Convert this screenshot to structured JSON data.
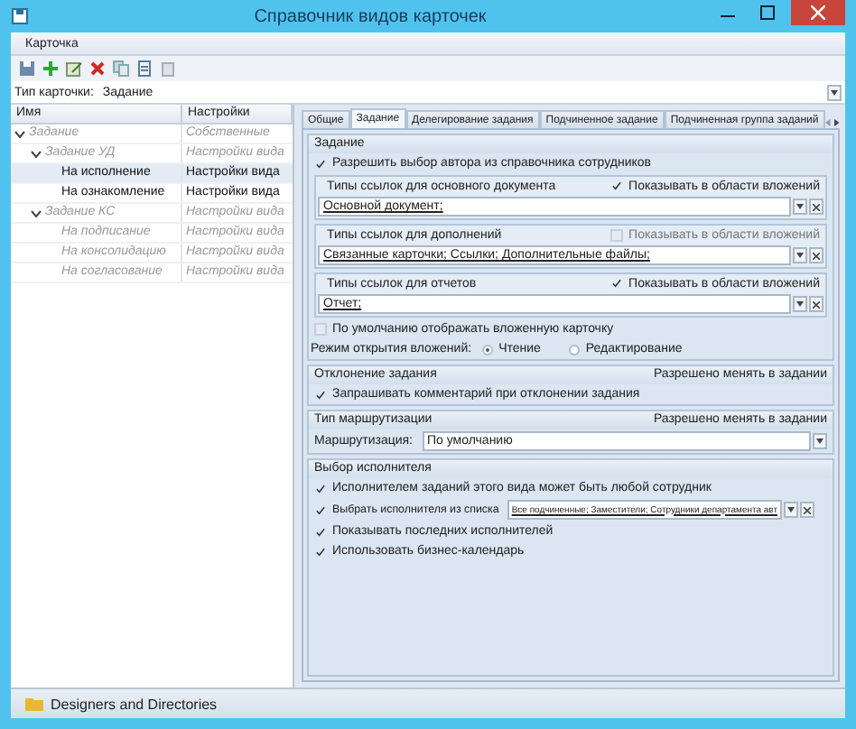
{
  "window": {
    "title": "Справочник видов карточек"
  },
  "menu": [
    "Карточка"
  ],
  "card_type": {
    "label": "Тип карточки:",
    "value": "Задание"
  },
  "tree": {
    "columns": [
      "Имя",
      "Настройки"
    ],
    "rows": [
      {
        "name": "Задание",
        "setting": "Собственные",
        "inherited": true,
        "selected": false,
        "expanded": true,
        "children": [
          {
            "name": "Задание УД",
            "setting": "Настройки вида",
            "inherited": true,
            "selected": false,
            "expanded": true,
            "children": [
              {
                "name": "На исполнение",
                "setting": "Настройки вида",
                "inherited": false,
                "selected": true
              },
              {
                "name": "На ознакомление",
                "setting": "Настройки вида",
                "inherited": false,
                "selected": false
              }
            ]
          },
          {
            "name": "Задание КС",
            "setting": "Настройки вида",
            "inherited": true,
            "selected": false,
            "expanded": true,
            "children": [
              {
                "name": "На подписание",
                "setting": "Настройки вида",
                "inherited": true,
                "selected": false
              },
              {
                "name": "На консолидацию",
                "setting": "Настройки вида",
                "inherited": true,
                "selected": false
              },
              {
                "name": "На согласование",
                "setting": "Настройки вида",
                "inherited": true,
                "selected": false
              }
            ]
          }
        ]
      }
    ]
  },
  "tabs": [
    {
      "label": "Общие",
      "selected": false
    },
    {
      "label": "Задание",
      "selected": true
    },
    {
      "label": "Делегирование задания",
      "selected": false
    },
    {
      "label": "Подчиненное задание",
      "selected": false
    },
    {
      "label": "Подчиненная группа заданий",
      "selected": false
    }
  ],
  "sections": [
    {
      "title": "Задание",
      "items": [
        {
          "kind": "checkbox",
          "label": "Разрешить выбор автора из справочника сотрудников",
          "checked": true
        },
        {
          "kind": "link-group",
          "title": "Типы ссылок для основного документа",
          "show": {
            "label": "Показывать в области вложений",
            "checked": true
          },
          "value": "Основной документ;"
        },
        {
          "kind": "link-group",
          "title": "Типы ссылок для дополнений",
          "show": {
            "label": "Показывать в области вложений",
            "checked": false
          },
          "value": "Связанные карточки; Ссылки; Дополнительные файлы;"
        },
        {
          "kind": "link-group",
          "title": "Типы ссылок для отчетов",
          "show": {
            "label": "Показывать в области вложений",
            "checked": true
          },
          "value": "Отчет;"
        },
        {
          "kind": "checkbox",
          "label": "По умолчанию отображать вложенную карточку",
          "checked": false
        },
        {
          "kind": "radio-group",
          "label": "Режим открытия вложений:",
          "options": [
            {
              "label": "Чтение",
              "selected": true
            },
            {
              "label": "Редактирование",
              "selected": false
            }
          ]
        }
      ]
    },
    {
      "title": "Отклонение задания",
      "note": "Разрешено менять в задании",
      "items": [
        {
          "kind": "checkbox",
          "label": "Запрашивать комментарий при отклонении задания",
          "checked": true
        }
      ]
    },
    {
      "title": "Тип маршрутизации",
      "note": "Разрешено менять в задании",
      "items": [
        {
          "kind": "select",
          "label": "Маршрутизация:",
          "value": "По умолчанию"
        }
      ]
    },
    {
      "title": "Выбор исполнителя",
      "items": [
        {
          "kind": "checkbox",
          "label": "Исполнителем заданий этого вида может быть любой сотрудник",
          "checked": true
        },
        {
          "kind": "checkbox-field",
          "label": "Выбрать исполнителя из списка",
          "checked": true,
          "value": "Все подчиненные; Заместители; Сотрудники департамента авт"
        },
        {
          "kind": "checkbox",
          "label": "Показывать последних исполнителей",
          "checked": true
        },
        {
          "kind": "checkbox",
          "label": "Использовать бизнес-календарь",
          "checked": true
        }
      ]
    }
  ],
  "status_bar": {
    "label": "Designers and Directories"
  }
}
